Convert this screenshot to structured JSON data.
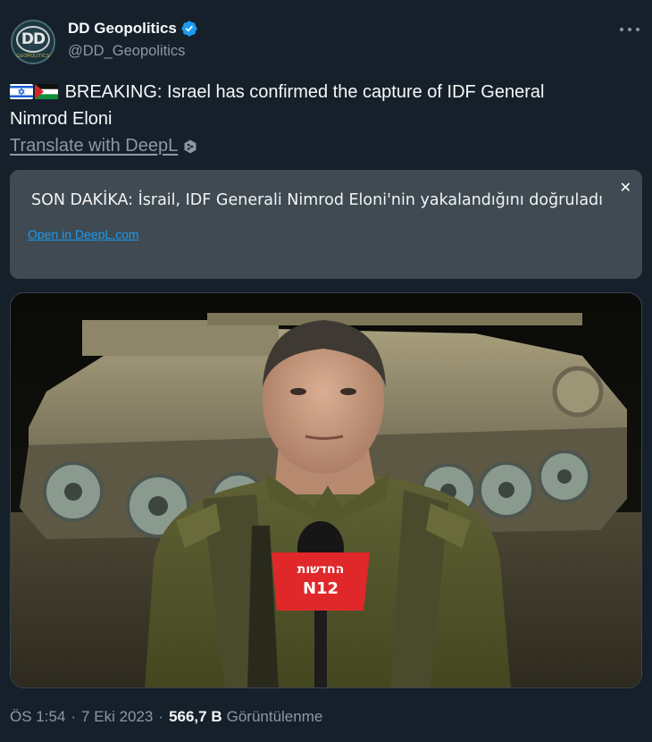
{
  "author": {
    "display_name": "DD Geopolitics",
    "handle": "@DD_Geopolitics",
    "avatar_text": "DD",
    "avatar_subtext": "GEOPOLITICS",
    "verified": true
  },
  "tweet": {
    "flags": [
      "israel-flag-icon",
      "palestine-flag-icon"
    ],
    "line1": "BREAKING: Israel has confirmed the capture of IDF General",
    "line2": "Nimrod Eloni",
    "translate_label": "Translate with DeepL "
  },
  "translation": {
    "text": "SON DAKİKA: İsrail, IDF Generali Nimrod Eloni'nin yakalandığını doğruladı",
    "open_link": "Open in DeepL.com",
    "close_icon": "close-icon"
  },
  "media": {
    "microphone_text_top": "החדשות",
    "microphone_text_bottom": "N12"
  },
  "meta": {
    "time": "ÖS 1:54",
    "separator": "·",
    "date": "7 Eki 2023",
    "views_count": "566,7 B",
    "views_label": "Görüntülenme"
  },
  "colors": {
    "background": "#15202b",
    "text_primary": "#f7f9f9",
    "text_secondary": "#8b98a5",
    "link_blue": "#1d9bf0",
    "card_bg": "#3f4a52",
    "mic_red": "#e0282a"
  }
}
